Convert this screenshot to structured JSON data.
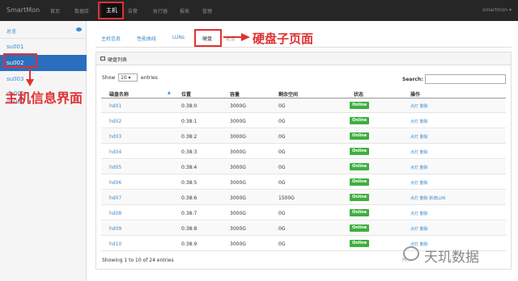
{
  "navbar": {
    "brand": "SmartMon",
    "items": [
      "首页",
      "数据库",
      "主机",
      "告警",
      "执行器",
      "报表",
      "管理"
    ],
    "user": "smartmon ▾"
  },
  "sidebar": {
    "header": "总览",
    "items": [
      "su001",
      "su002",
      "su003",
      "du001",
      "du002"
    ]
  },
  "annotations": {
    "host_info": "主机信息界面",
    "disk_subpage": "硬盘子页面",
    "color": "#e03131"
  },
  "tabs": [
    "主机信息",
    "性能曲线",
    "LUNs",
    "硬盘",
    "配置"
  ],
  "panel": {
    "title": "硬盘列表",
    "show_label": "Show",
    "entries_value": "10 ▾",
    "entries_label": "entries",
    "search_label": "Search:"
  },
  "table": {
    "headers": [
      "磁盘名称",
      "位置",
      "容量",
      "剩余空间",
      "状态",
      "操作"
    ],
    "rows": [
      {
        "name": "hd01",
        "position": "0:38:0",
        "capacity": "3000G",
        "free": "0G",
        "status": "Online",
        "actions": "点灯 删除"
      },
      {
        "name": "hd02",
        "position": "0:38:1",
        "capacity": "3000G",
        "free": "0G",
        "status": "Online",
        "actions": "点灯 删除"
      },
      {
        "name": "hd03",
        "position": "0:38:2",
        "capacity": "3000G",
        "free": "0G",
        "status": "Online",
        "actions": "点灯 删除"
      },
      {
        "name": "hd04",
        "position": "0:38:3",
        "capacity": "3000G",
        "free": "0G",
        "status": "Online",
        "actions": "点灯 删除"
      },
      {
        "name": "hd05",
        "position": "0:38:4",
        "capacity": "3000G",
        "free": "0G",
        "status": "Online",
        "actions": "点灯 删除"
      },
      {
        "name": "hd06",
        "position": "0:38:5",
        "capacity": "3000G",
        "free": "0G",
        "status": "Online",
        "actions": "点灯 删除"
      },
      {
        "name": "hd07",
        "position": "0:38:6",
        "capacity": "3000G",
        "free": "1500G",
        "status": "Online",
        "actions": "点灯 删除 新增LUN"
      },
      {
        "name": "hd08",
        "position": "0:38:7",
        "capacity": "3000G",
        "free": "0G",
        "status": "Online",
        "actions": "点灯 删除"
      },
      {
        "name": "hd09",
        "position": "0:38:8",
        "capacity": "3000G",
        "free": "0G",
        "status": "Online",
        "actions": "点灯 删除"
      },
      {
        "name": "hd10",
        "position": "0:38:9",
        "capacity": "3000G",
        "free": "0G",
        "status": "Online",
        "actions": "点灯 删除"
      }
    ],
    "info": "Showing 1 to 10 of 24 entries",
    "pager": "Pr..."
  },
  "watermark": {
    "text": "天玑数据"
  }
}
